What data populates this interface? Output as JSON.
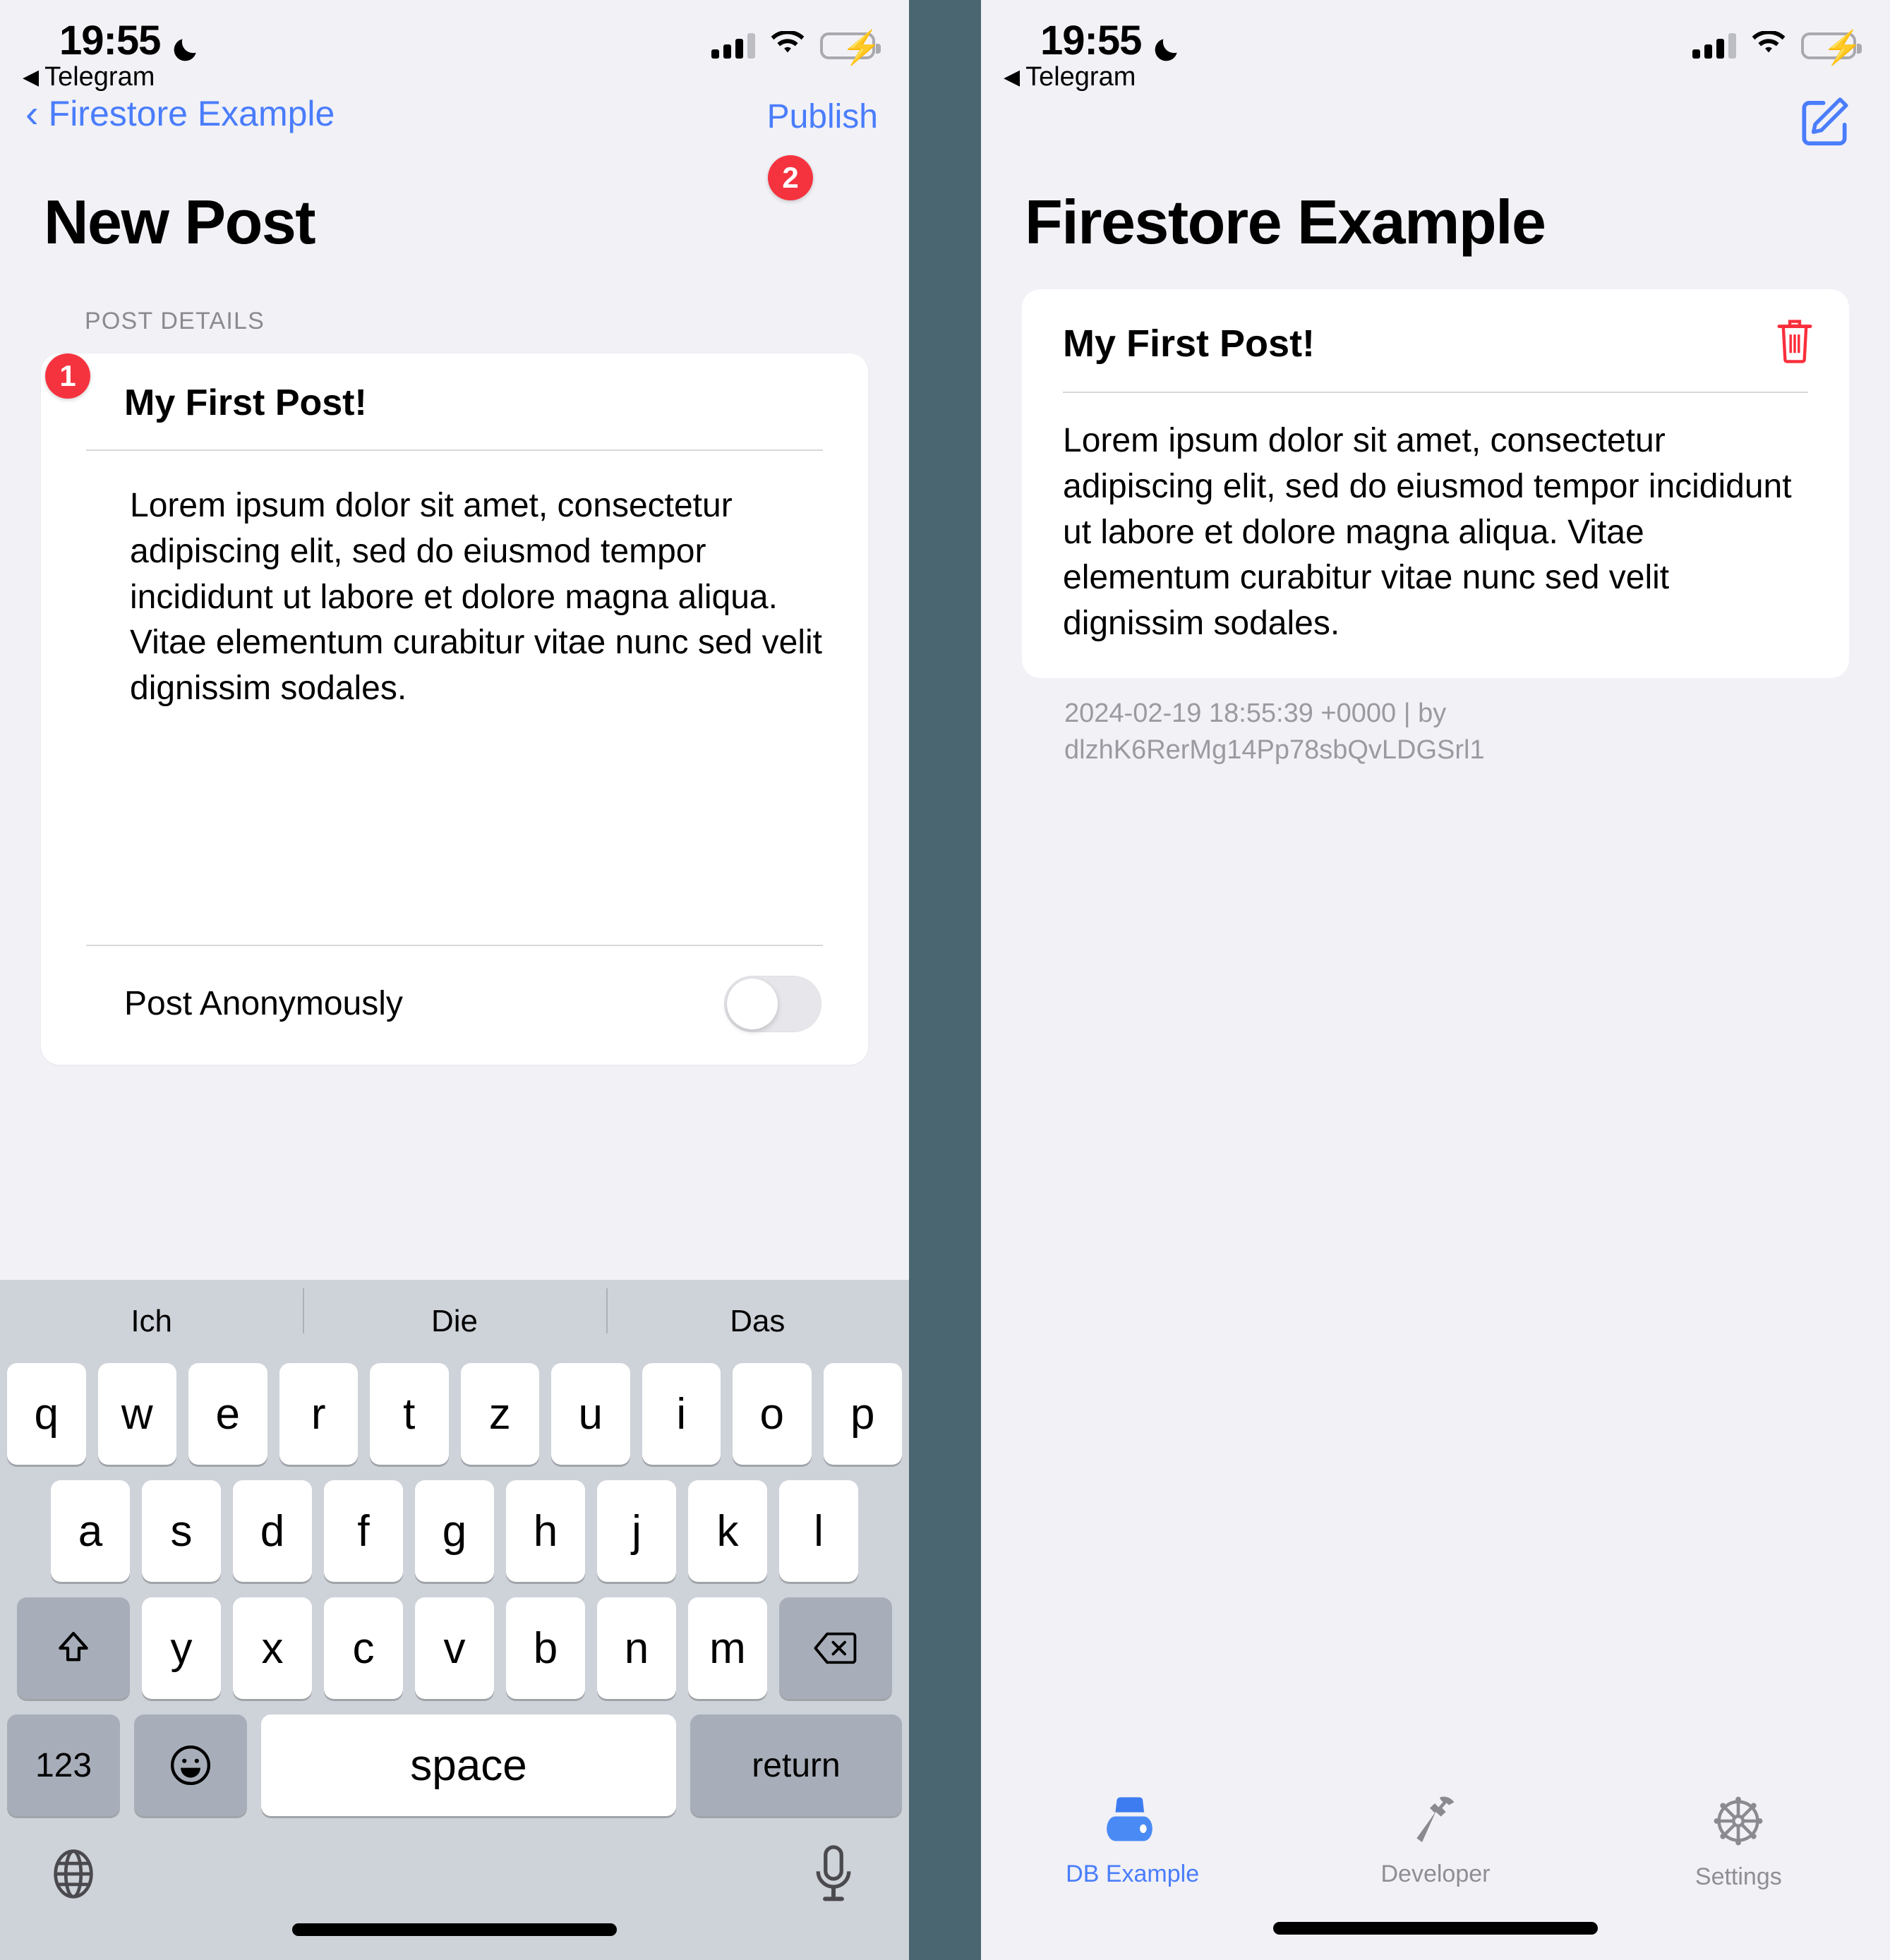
{
  "divider_color": "#4a6670",
  "accent_blue": "#4a7dfc",
  "badge_red": "#f5333f",
  "trash_red": "#fa2f3b",
  "left": {
    "status": {
      "time": "19:55",
      "moon_icon": "moon-icon",
      "back_app": "Telegram",
      "back_triangle": "◀",
      "signal_icon": "cellular-signal-icon",
      "wifi_icon": "wifi-icon",
      "battery_icon": "battery-charging-icon"
    },
    "nav": {
      "back_label": "Firestore Example",
      "back_chevron": "‹",
      "action_label": "Publish",
      "publish_badge": "2"
    },
    "title": "New Post",
    "section_header": "POST DETAILS",
    "title_badge": "1",
    "post": {
      "title": "My First Post!",
      "body": "Lorem ipsum dolor sit amet, consectetur adipiscing elit, sed do eiusmod tempor incididunt ut labore et dolore magna aliqua. Vitae elementum curabitur vitae nunc sed velit dignissim sodales."
    },
    "toggle": {
      "label": "Post Anonymously",
      "value": "off"
    },
    "keyboard": {
      "predictions": [
        "Ich",
        "Die",
        "Das"
      ],
      "row1": [
        "q",
        "w",
        "e",
        "r",
        "t",
        "z",
        "u",
        "i",
        "o",
        "p"
      ],
      "row2": [
        "a",
        "s",
        "d",
        "f",
        "g",
        "h",
        "j",
        "k",
        "l"
      ],
      "row3": [
        "y",
        "x",
        "c",
        "v",
        "b",
        "n",
        "m"
      ],
      "shift_icon": "shift-up-arrow-icon",
      "backspace_icon": "backspace-delete-icon",
      "numbers_key": "123",
      "emoji_icon": "emoji-smiley-icon",
      "space_key": "space",
      "return_key": "return",
      "globe_icon": "globe-language-icon",
      "mic_icon": "microphone-dictation-icon"
    }
  },
  "right": {
    "status": {
      "time": "19:55",
      "moon_icon": "moon-icon",
      "back_app": "Telegram",
      "back_triangle": "◀",
      "signal_icon": "cellular-signal-icon",
      "wifi_icon": "wifi-icon",
      "battery_icon": "battery-charging-icon"
    },
    "compose_icon": "compose-new-post-icon",
    "title": "Firestore Example",
    "post": {
      "title": "My First Post!",
      "delete_icon": "trash-delete-icon",
      "body": "Lorem ipsum dolor sit amet, consectetur adipiscing elit, sed do eiusmod tempor incididunt ut labore et dolore magna aliqua. Vitae elementum curabitur vitae nunc sed velit dignissim sodales.",
      "meta": "2024-02-19 18:55:39 +0000 | by dlzhK6RerMg14Pp78sbQvLDGSrl1"
    },
    "tabs": [
      {
        "label": "DB Example",
        "icon": "database-icon",
        "selected": true
      },
      {
        "label": "Developer",
        "icon": "hammer-icon",
        "selected": false
      },
      {
        "label": "Settings",
        "icon": "gear-icon",
        "selected": false
      }
    ]
  }
}
